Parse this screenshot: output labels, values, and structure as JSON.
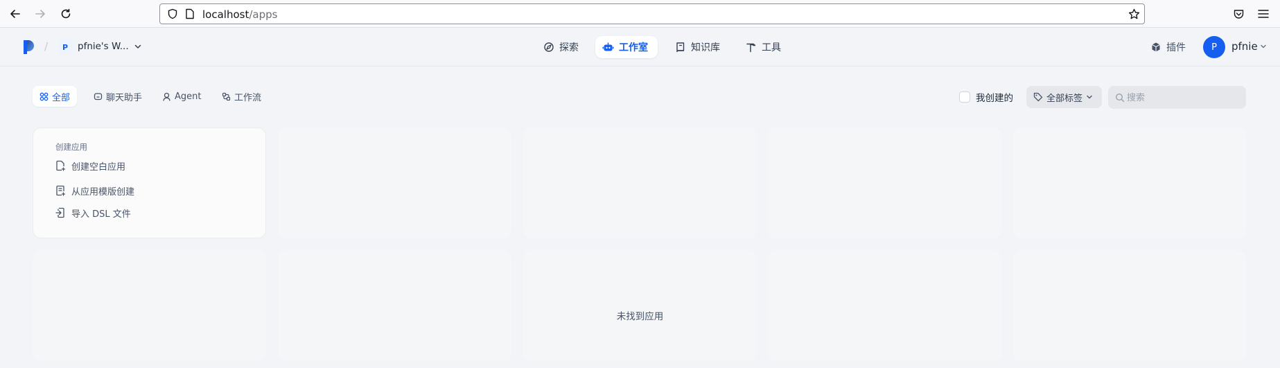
{
  "browser": {
    "url_host": "localhost",
    "url_path": "/apps"
  },
  "header": {
    "workspace_badge": "P",
    "workspace_name": "pfnie's W...",
    "nav": [
      {
        "label": "探索",
        "icon": "compass-icon"
      },
      {
        "label": "工作室",
        "icon": "robot-icon"
      },
      {
        "label": "知识库",
        "icon": "book-icon"
      },
      {
        "label": "工具",
        "icon": "hammer-icon"
      }
    ],
    "active_nav": "工作室",
    "plugin_label": "插件",
    "user_initial": "P",
    "user_name": "pfnie"
  },
  "filters": {
    "tabs": [
      {
        "label": "全部",
        "icon": "grid-icon"
      },
      {
        "label": "聊天助手",
        "icon": "chat-icon"
      },
      {
        "label": "Agent",
        "icon": "agent-icon"
      },
      {
        "label": "工作流",
        "icon": "workflow-icon"
      }
    ],
    "active_tab": "全部",
    "mine_label": "我创建的",
    "mine_checked": false,
    "tag_label": "全部标签",
    "search_placeholder": "搜索",
    "search_value": ""
  },
  "create_card": {
    "title": "创建应用",
    "items": [
      {
        "label": "创建空白应用",
        "icon": "new-file-icon"
      },
      {
        "label": "从应用模版创建",
        "icon": "template-icon"
      },
      {
        "label": "导入 DSL 文件",
        "icon": "import-icon"
      }
    ]
  },
  "empty_message": "未找到应用",
  "colors": {
    "accent": "#155eef",
    "page_bg": "#f2f4f7",
    "card_bg": "#f5f6f8"
  }
}
